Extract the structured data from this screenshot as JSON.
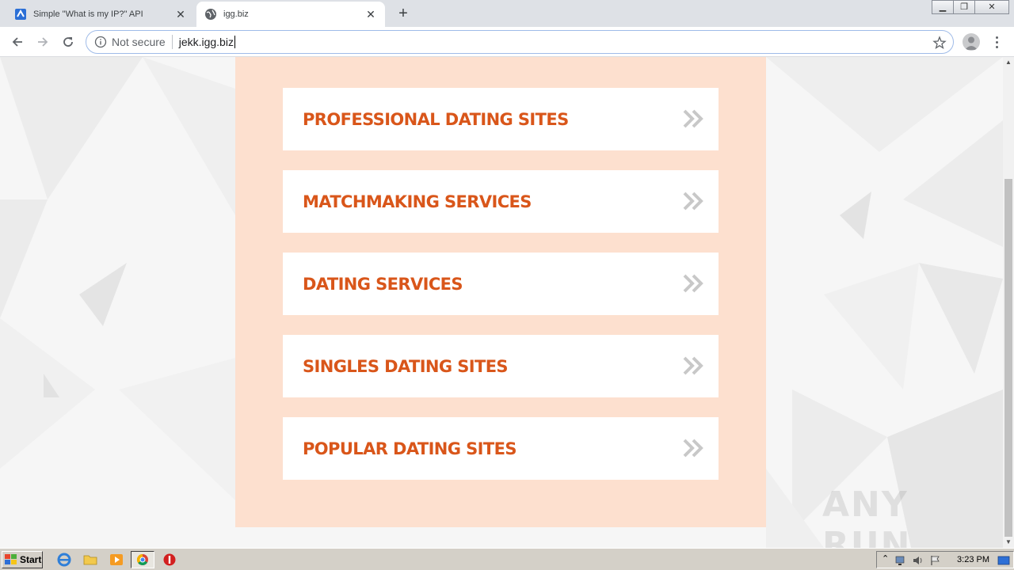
{
  "browser": {
    "tabs": [
      {
        "title": "Simple \"What is my IP?\" API",
        "active": false
      },
      {
        "title": "igg.biz",
        "active": true
      }
    ],
    "new_tab_label": "+",
    "address": {
      "security_label": "Not secure",
      "url": "jekk.igg.biz"
    }
  },
  "page": {
    "menu_items": [
      {
        "label": "PROFESSIONAL DATING SITES"
      },
      {
        "label": "MATCHMAKING SERVICES"
      },
      {
        "label": "DATING SERVICES"
      },
      {
        "label": "SINGLES DATING SITES"
      },
      {
        "label": "POPULAR DATING SITES"
      }
    ],
    "watermark": "ANY RUN"
  },
  "colors": {
    "panel_bg": "#fde0cf",
    "item_text": "#d9561a",
    "chevron": "#c8c8c8"
  },
  "taskbar": {
    "start_label": "Start",
    "clock": "3:23 PM"
  }
}
